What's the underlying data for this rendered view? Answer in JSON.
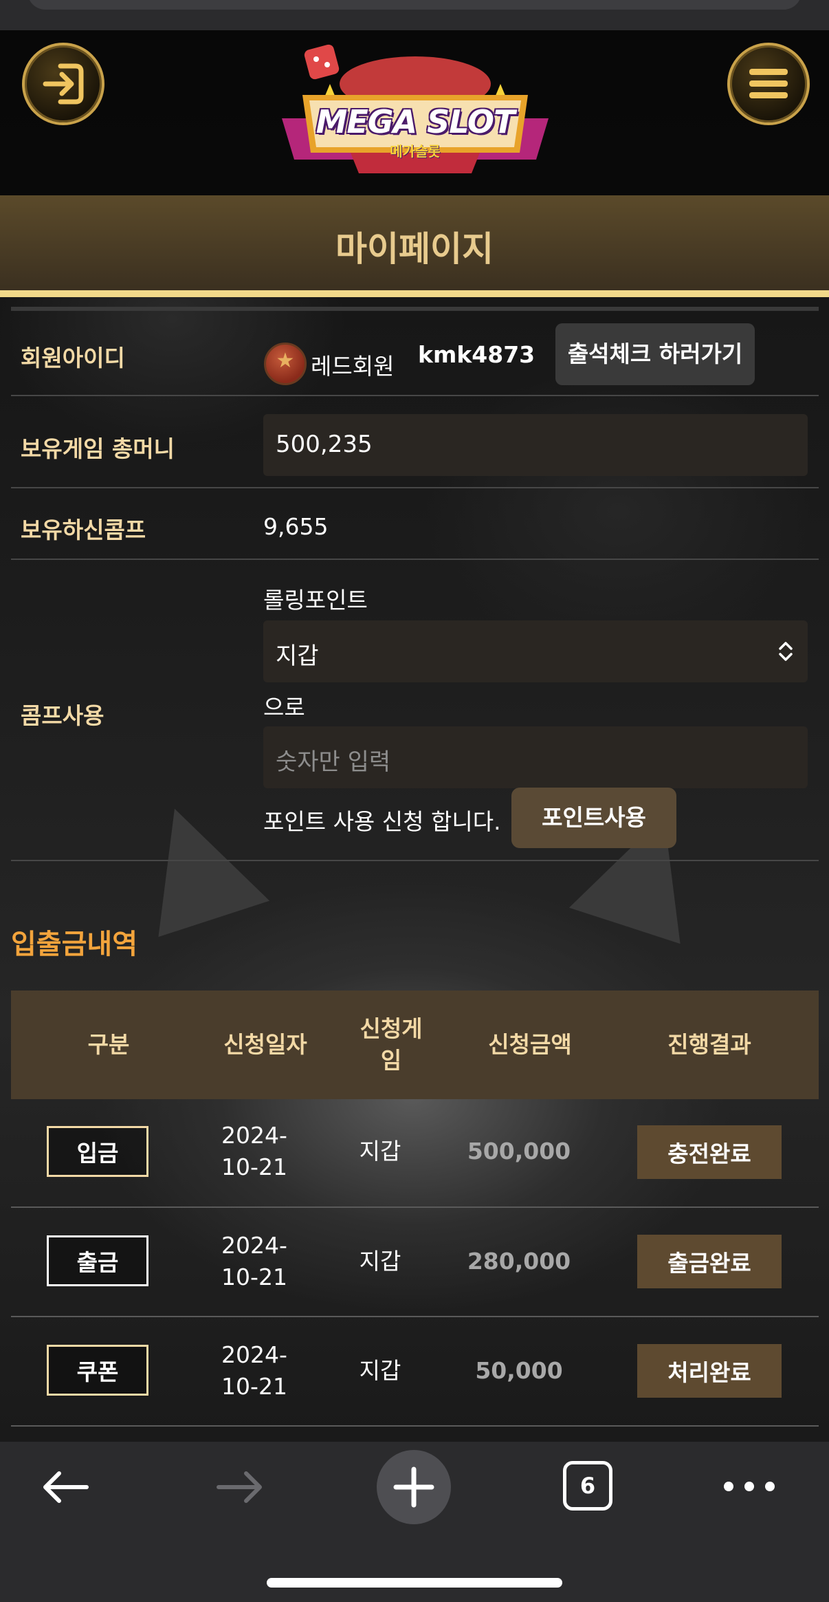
{
  "header": {
    "logo_text": "MEGA SLOT",
    "logo_sub": "메가슬롯"
  },
  "page_title": "마이페이지",
  "profile": {
    "member_id_label": "회원아이디",
    "member_grade": "레드회원",
    "member_id": "kmk4873",
    "attend_button": "출석체크 하러가기",
    "game_money_label": "보유게임 총머니",
    "game_money_value": "500,235",
    "comp_label": "보유하신콤프",
    "comp_value": "9,655",
    "comp_use_label": "콤프사용",
    "rolling_point_label": "롤링포인트",
    "wallet_select_value": "지갑",
    "to_text": "으로",
    "amount_placeholder": "숫자만 입력",
    "request_text": "포인트 사용 신청 합니다.",
    "point_button": "포인트사용"
  },
  "history": {
    "title": "입출금내역",
    "columns": [
      "구분",
      "신청일자",
      "신청게임",
      "신청금액",
      "진행결과"
    ],
    "column_game_lines": [
      "신청게",
      "임"
    ],
    "rows": [
      {
        "type": "입금",
        "date_line1": "2024-",
        "date_line2": "10-21",
        "game": "지갑",
        "amount": "500,000",
        "status": "충전완료"
      },
      {
        "type": "출금",
        "date_line1": "2024-",
        "date_line2": "10-21",
        "game": "지갑",
        "amount": "280,000",
        "status": "출금완료"
      },
      {
        "type": "쿠폰",
        "date_line1": "2024-",
        "date_line2": "10-21",
        "game": "지갑",
        "amount": "50,000",
        "status": "처리완료"
      }
    ]
  },
  "browser": {
    "tab_count": "6"
  },
  "colors": {
    "accent_gold": "#f3d9a6",
    "section_orange": "#f3a43c",
    "status_brown": "#5e4a30"
  }
}
